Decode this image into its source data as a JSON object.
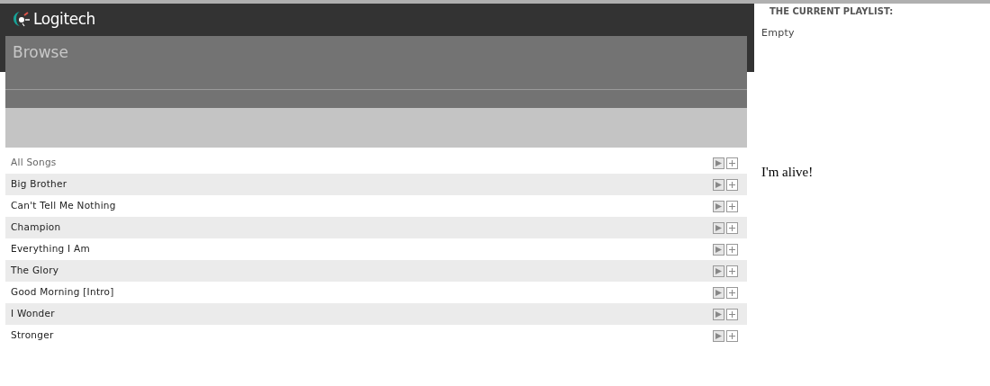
{
  "header": {
    "logo_text": "Logitech"
  },
  "browse": {
    "title": "Browse"
  },
  "rows": [
    {
      "kind": "all",
      "label": "All Songs"
    },
    {
      "kind": "song",
      "label": "Big Brother"
    },
    {
      "kind": "song",
      "label": "Can't Tell Me Nothing"
    },
    {
      "kind": "song",
      "label": "Champion"
    },
    {
      "kind": "song",
      "label": "Everything I Am"
    },
    {
      "kind": "song",
      "label": "The Glory"
    },
    {
      "kind": "song",
      "label": "Good Morning [Intro]"
    },
    {
      "kind": "song",
      "label": "I Wonder"
    },
    {
      "kind": "song",
      "label": "Stronger"
    }
  ],
  "playlist": {
    "title": "THE CURRENT PLAYLIST:",
    "status": "Empty"
  },
  "message": "I'm alive!"
}
